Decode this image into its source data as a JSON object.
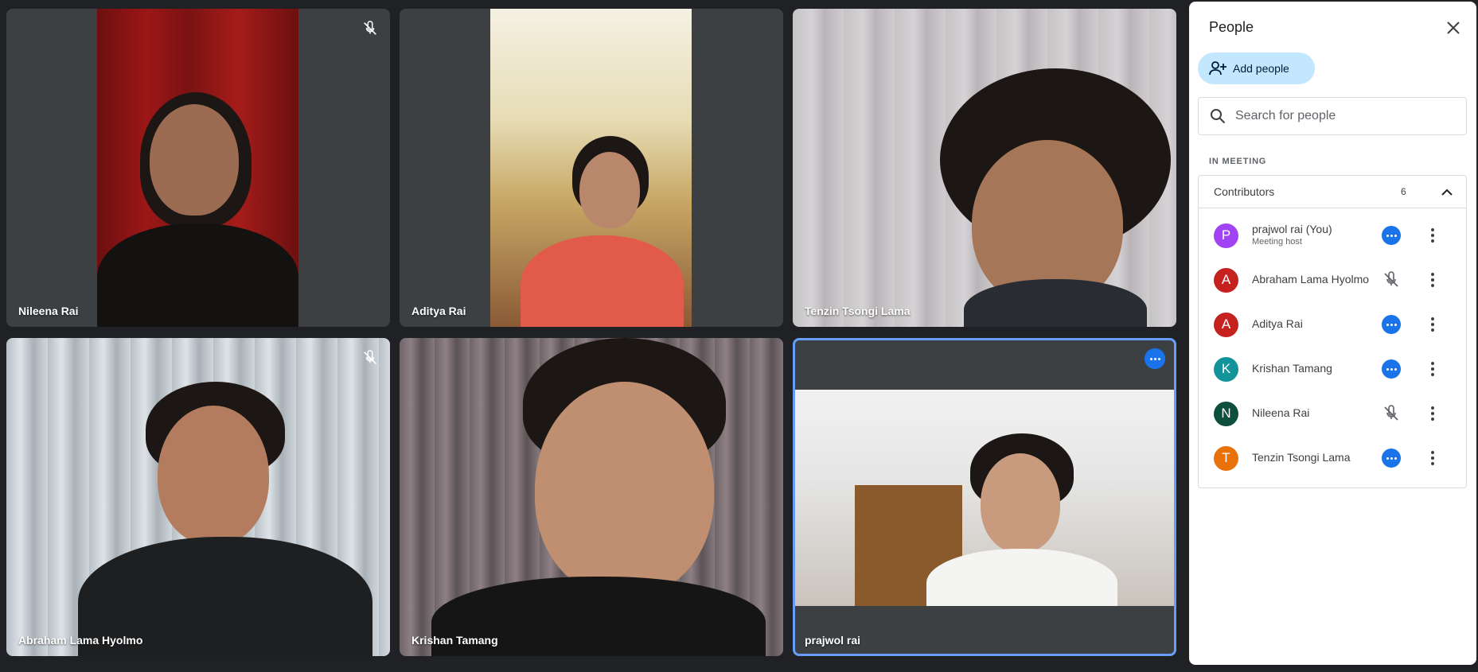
{
  "tiles": [
    {
      "name": "Nileena Rai",
      "muted": true
    },
    {
      "name": "Aditya Rai",
      "muted": false
    },
    {
      "name": "Tenzin Tsongi Lama",
      "muted": false
    },
    {
      "name": "Abraham Lama Hyolmo",
      "muted": true
    },
    {
      "name": "Krishan Tamang",
      "muted": false
    },
    {
      "name": "prajwol rai",
      "muted": false,
      "active_speaker": true
    }
  ],
  "panel": {
    "title": "People",
    "close_icon": "close-icon",
    "add_people_label": "Add people",
    "search_placeholder": "Search for people",
    "section_label": "IN MEETING",
    "group": {
      "title": "Contributors",
      "count": "6"
    },
    "participants": [
      {
        "initial": "P",
        "name": "prajwol rai (You)",
        "subtitle": "Meeting host",
        "color": "#a142f4",
        "status": "more-options"
      },
      {
        "initial": "A",
        "name": "Abraham Lama Hyolmo",
        "subtitle": "",
        "color": "#c5221f",
        "status": "mic-off"
      },
      {
        "initial": "A",
        "name": "Aditya Rai",
        "subtitle": "",
        "color": "#c5221f",
        "status": "more-options"
      },
      {
        "initial": "K",
        "name": "Krishan Tamang",
        "subtitle": "",
        "color": "#12939a",
        "status": "more-options"
      },
      {
        "initial": "N",
        "name": "Nileena Rai",
        "subtitle": "",
        "color": "#0d4f3c",
        "status": "mic-off"
      },
      {
        "initial": "T",
        "name": "Tenzin Tsongi Lama",
        "subtitle": "",
        "color": "#e8710a",
        "status": "more-options"
      }
    ]
  },
  "colors": {
    "accent": "#1a73e8",
    "add_button_bg": "#c2e7ff",
    "active_border": "#669df6",
    "tile_bg": "#3c4043",
    "page_bg": "#202124"
  }
}
